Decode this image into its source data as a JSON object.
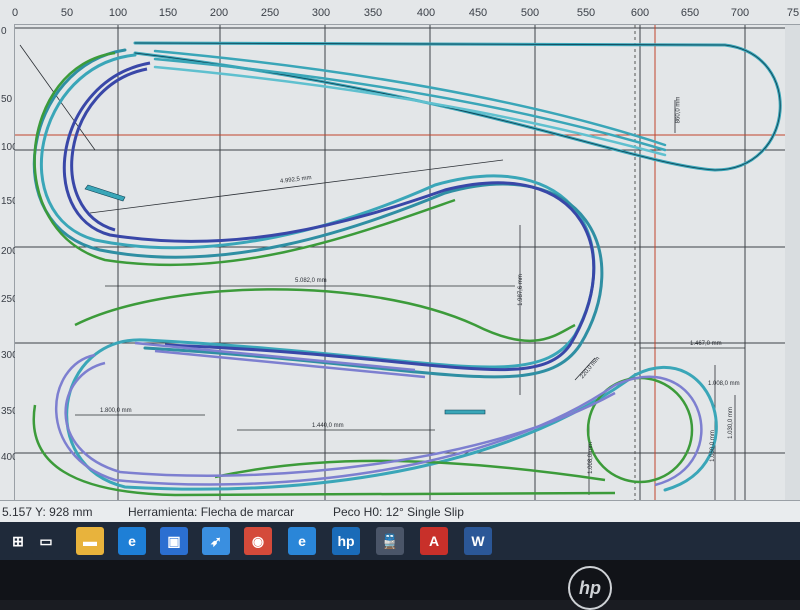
{
  "ruler": {
    "x_ticks": [
      "0",
      "50",
      "100",
      "150",
      "200",
      "250",
      "300",
      "350",
      "400",
      "450",
      "500",
      "550",
      "600",
      "650",
      "700",
      "75"
    ],
    "y_ticks": [
      "0",
      "50",
      "100",
      "150",
      "200",
      "250",
      "300",
      "350",
      "400"
    ]
  },
  "dimensions": {
    "d1": "4.992,5 mm",
    "d2": "5.082,0 mm",
    "d3": "1.987,6 mm",
    "d4": "1.467,0 mm",
    "d5": "1.008,0 mm",
    "d6": "1.030,0 mm",
    "d7": "1.800,0 mm",
    "d8": "1.440,0 mm",
    "d9": "1.008,0 mm",
    "d10": "1.050,0 mm",
    "d11": "220,0 mm",
    "d12": "860,0 mm"
  },
  "status": {
    "coords": "5.157   Y: 928 mm",
    "tool": "Herramienta: Flecha de marcar",
    "part": "Peco H0: 12° Single Slip"
  },
  "taskbar": {
    "items": [
      {
        "name": "start-icon",
        "glyph": "⊞",
        "color": "#1f2a3a"
      },
      {
        "name": "task-view-icon",
        "glyph": "▭",
        "color": "#1f2a3a"
      },
      {
        "name": "file-explorer-icon",
        "glyph": "▬",
        "color": "#e8b33c"
      },
      {
        "name": "edge-icon",
        "glyph": "e",
        "color": "#1e7fd6"
      },
      {
        "name": "store-icon",
        "glyph": "▣",
        "color": "#2b6fd1"
      },
      {
        "name": "rocket-app-icon",
        "glyph": "➶",
        "color": "#3a8fe0"
      },
      {
        "name": "chrome-icon",
        "glyph": "◉",
        "color": "#d44a3a"
      },
      {
        "name": "ie-icon",
        "glyph": "e",
        "color": "#2a86d8"
      },
      {
        "name": "hp-icon",
        "glyph": "hp",
        "color": "#1a6bb8"
      },
      {
        "name": "train-app-icon",
        "glyph": "🚆",
        "color": "#4a5568"
      },
      {
        "name": "acrobat-icon",
        "glyph": "A",
        "color": "#c8302a"
      },
      {
        "name": "word-icon",
        "glyph": "W",
        "color": "#2b5797"
      }
    ]
  },
  "bezel": {
    "logo": "hp"
  },
  "colors": {
    "grid": "#22262c",
    "red_guide": "#c0442c",
    "track_teal": "#3aa6b8",
    "track_green": "#3c9b3a",
    "track_blue": "#3947a8",
    "track_lilac": "#7d7fd0"
  }
}
